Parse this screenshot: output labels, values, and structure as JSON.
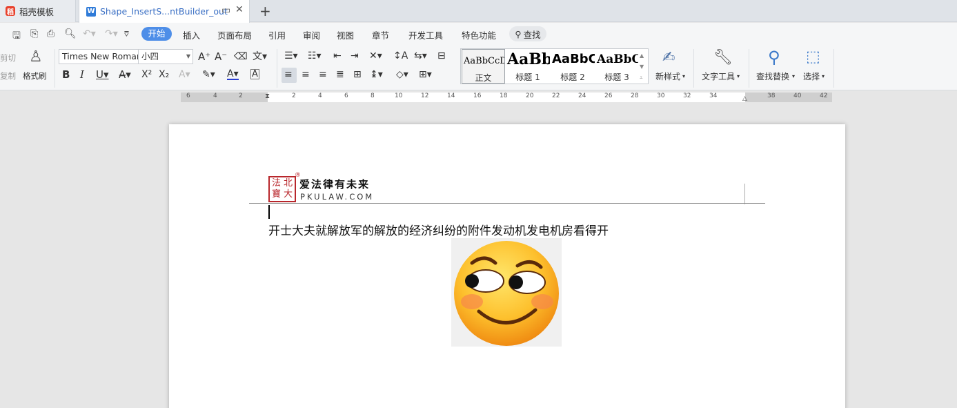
{
  "tabs": [
    {
      "label": "稻壳模板",
      "logo": "稻"
    },
    {
      "label": "Shape_InsertS...ntBuilder_out",
      "logo": "W"
    }
  ],
  "menu": {
    "items": [
      "插入",
      "页面布局",
      "引用",
      "审阅",
      "视图",
      "章节",
      "开发工具",
      "特色功能"
    ],
    "active": "开始",
    "search": "查找"
  },
  "ribbon": {
    "clipboard": {
      "cut": "剪切",
      "copy": "复制",
      "format_painter": "格式刷"
    },
    "font": {
      "name": "Times New Roman",
      "size": "小四"
    },
    "styles": [
      {
        "preview": "AaBbCcDd",
        "name": "正文"
      },
      {
        "preview": "AaBb",
        "name": "标题 1"
      },
      {
        "preview": "AaBbC",
        "name": "标题 2"
      },
      {
        "preview": "AaBbC",
        "name": "标题 3"
      }
    ],
    "new_style": "新样式",
    "text_tools": "文字工具",
    "find_replace": "查找替换",
    "select": "选择"
  },
  "ruler": {
    "left_numbers": [
      "6",
      "4",
      "2"
    ],
    "numbers": [
      "2",
      "4",
      "6",
      "8",
      "10",
      "12",
      "14",
      "16",
      "18",
      "20",
      "22",
      "24",
      "26",
      "28",
      "30",
      "32",
      "34"
    ],
    "right_numbers": [
      "38",
      "40",
      "42"
    ]
  },
  "document": {
    "header": {
      "seal_chars": [
        "法",
        "北",
        "寶",
        "大"
      ],
      "registered": "®",
      "slogan": "爱法律有未来",
      "domain": "PKULAW.COM"
    },
    "body_text": "开士大夫就解放军的解放的经济纠纷的附件发动机发电机房看得开"
  }
}
